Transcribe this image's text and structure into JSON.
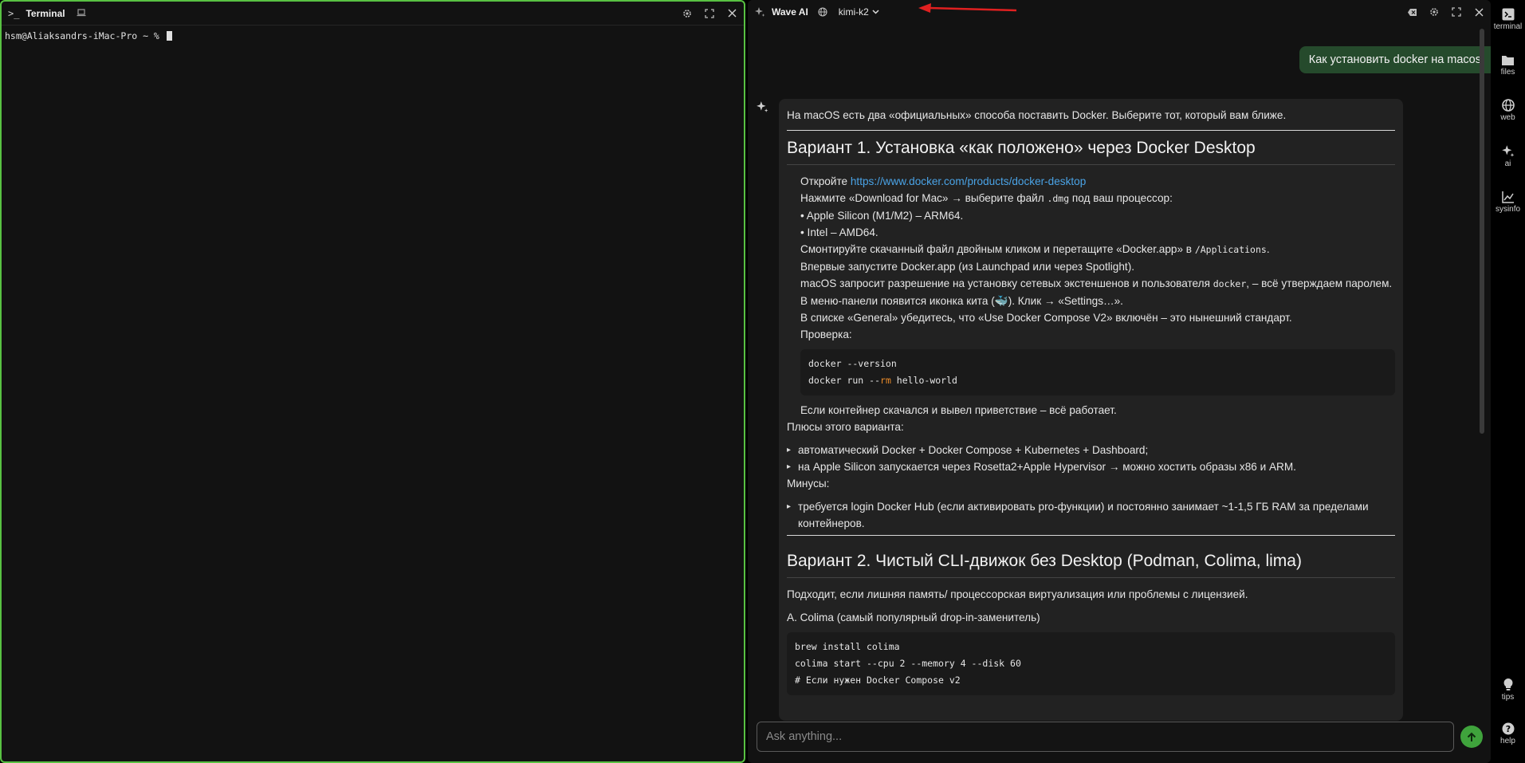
{
  "terminal": {
    "title": "Terminal",
    "prompt": "hsm@Aliaksandrs-iMac-Pro ~ %"
  },
  "wave": {
    "title": "Wave AI",
    "model": "kimi-k2",
    "user_message": "Как установить docker на macos",
    "input_placeholder": "Ask anything...",
    "answer": {
      "intro": "На macOS есть два «официальных» способа поставить Docker. Выберите тот, который вам ближе.",
      "h1": "Вариант 1. Установка «как положено» через Docker Desktop",
      "s1_open": "Откройте ",
      "s1_link": "https://www.docker.com/products/docker-desktop",
      "s1_l2a": "Нажмите «Download for Mac» → выберите файл ",
      "s1_l2code": ".dmg",
      "s1_l2b": " под ваш процессор:",
      "s1_l3": "• Apple Silicon (M1/M2) – ARM64.",
      "s1_l4": "• Intel – AMD64.",
      "s1_l5a": "Смонтируйте скачанный файл двойным кликом и перетащите «Docker.app» в ",
      "s1_l5code": "/Applications",
      "s1_l5b": ".",
      "s1_l6": "Впервые запустите Docker.app (из Launchpad или через Spotlight).",
      "s1_l7a": "macOS запросит разрешение на установку сетевых экстеншенов и пользователя ",
      "s1_l7code": "docker",
      "s1_l7b": ", – всё утверждаем паролем.",
      "s1_l8a": "В меню-панели появится иконка кита (",
      "s1_l8emoji": "🐳",
      "s1_l8b": "). Клик → «Settings…».",
      "s1_l9": "В списке «General» убедитесь, что «Use Docker Compose V2» включён – это нынешний стандарт.",
      "s1_l10": "Проверка:",
      "code1_l1": "docker --version",
      "code1_l2a": "docker run --",
      "code1_l2b": "rm",
      "code1_l2c": " hello-world",
      "s1_after": "Если контейнер скачался и вывел приветствие – всё работает.",
      "pros_title": "Плюсы этого варианта:",
      "pro1": "автоматический Docker + Docker Compose + Kubernetes + Dashboard;",
      "pro2": "на Apple Silicon запускается через Rosetta2+Apple Hypervisor → можно хостить образы x86 и ARM.",
      "cons_title": "Минусы:",
      "con1": "требуется login Docker Hub (если активировать pro-функции) и постоянно занимает ~1-1,5 ГБ RAM за пределами контейнеров.",
      "h2": "Вариант 2. Чистый CLI-движок без Desktop (Podman, Colima, lima)",
      "s2_intro": "Подходит, если лишняя память/ процессорская виртуализация или проблемы с лицензией.",
      "s2_a": "A. Colima (самый популярный drop-in-заменитель)",
      "code2_l1": "brew install colima",
      "code2_l2": "colima start --cpu 2 --memory 4 --disk 60",
      "code2_l3": "# Если нужен Docker Compose v2"
    }
  },
  "sidebar": {
    "items": [
      "terminal",
      "files",
      "web",
      "ai",
      "sysinfo"
    ],
    "bottom": [
      "tips",
      "help"
    ]
  },
  "colors": {
    "terminal_border": "#58c142",
    "user_bubble": "#254a2c",
    "send_button": "#3fa33c",
    "link": "#4aa3e6",
    "annotation_arrow": "#e02020"
  }
}
